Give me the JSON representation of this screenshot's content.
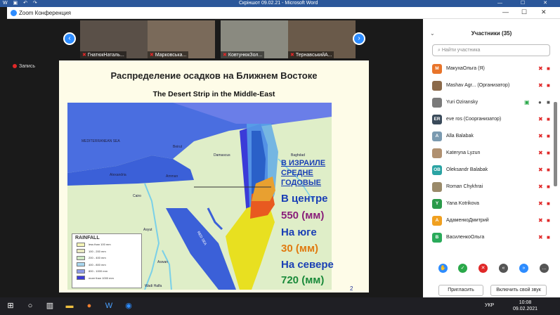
{
  "word": {
    "title": "Скріншот 09.02.21 - Microsoft Word"
  },
  "zoom": {
    "title": "Zoom Конференция",
    "recording": "Запись"
  },
  "thumbnails": [
    {
      "name": "ГнатюкНаталь..."
    },
    {
      "name": "Марковська..."
    },
    {
      "name": "КовтунюкЗол..."
    },
    {
      "name": "ТернавськийА..."
    }
  ],
  "slide": {
    "title": "Распределение осадков на Ближнем Востоке",
    "map_title": "The Desert Strip in the Middle-East",
    "page": "2",
    "lines": [
      {
        "text": "В ИЗРАИЛЕ",
        "color": "#1a3fb5"
      },
      {
        "text": "СРЕДНЕ",
        "color": "#1a3fb5"
      },
      {
        "text": "ГОДОВЫЕ",
        "color": "#1a3fb5"
      },
      {
        "text": "В центре",
        "color": "#1a3fb5"
      },
      {
        "text": "550 (мм)",
        "color": "#8a1f7a"
      },
      {
        "text": "На юге",
        "color": "#1a3fb5"
      },
      {
        "text": "30 (мм)",
        "color": "#e07a10"
      },
      {
        "text": "На севере",
        "color": "#1a3fb5"
      },
      {
        "text": "720 (мм)",
        "color": "#1a8a3a"
      }
    ],
    "map_labels": {
      "sea": "MEDITERRANEAN SEA",
      "damascus": "Damascus",
      "baghdad": "Baghdad",
      "cairo": "Cairo",
      "aswan": "Aswan",
      "assyut": "Asyut",
      "wadi_halfa": "Wadi Halfa",
      "red_sea": "RED SEA",
      "alexandria": "Alexandria",
      "amman": "Amman",
      "beirut": "Beirut"
    },
    "legend": {
      "title": "RAINFALL",
      "items": [
        {
          "label": "less than 100 mm",
          "color": "#f4f4b8"
        },
        {
          "label": "100 - 200 mm",
          "color": "#e8e8c0"
        },
        {
          "label": "200 - 400 mm",
          "color": "#cfe9c4"
        },
        {
          "label": "400 - 800 mm",
          "color": "#a9d8f0"
        },
        {
          "label": "800 - 1000 mm",
          "color": "#8c9be8"
        },
        {
          "label": "more than 1000 mm",
          "color": "#3b3bd8"
        }
      ]
    }
  },
  "participants": {
    "title": "Участники",
    "count": "(35)",
    "search_placeholder": "Найти участника",
    "list": [
      {
        "initial": "M",
        "name": "МакухаОльга (Я)",
        "color": "#e8742a",
        "video": false
      },
      {
        "initial": "",
        "name": "Mashav Agr... (Организатор)",
        "color": "#8b6a4a",
        "video": false
      },
      {
        "initial": "",
        "name": "Yuri Oziransky",
        "color": "#7a7a7a",
        "video": true
      },
      {
        "initial": "ER",
        "name": "eve ros (Соорганизатор)",
        "color": "#3a4a5a",
        "video": false
      },
      {
        "initial": "A",
        "name": "Alla Balabak",
        "color": "#7a9ab0",
        "video": false
      },
      {
        "initial": "",
        "name": "Kateryna Lyzun",
        "color": "#b09070",
        "video": false
      },
      {
        "initial": "OB",
        "name": "Oleksandr Balabak",
        "color": "#2aa3a3",
        "video": false
      },
      {
        "initial": "",
        "name": "Roman Chykhrai",
        "color": "#9a8a6a",
        "video": false
      },
      {
        "initial": "Y",
        "name": "Yana Kotrikova",
        "color": "#2a9a4a",
        "video": false
      },
      {
        "initial": "A",
        "name": "АдаменкоДмитрий",
        "color": "#f0a020",
        "video": false
      },
      {
        "initial": "B",
        "name": "ВасиленкоОльга",
        "color": "#2aaa5a",
        "video": false
      }
    ],
    "invite": "Пригласить",
    "unmute": "Включить свой звук"
  },
  "taskbar": {
    "lang": "УКР",
    "time": "10:08",
    "date": "09.02.2021"
  }
}
